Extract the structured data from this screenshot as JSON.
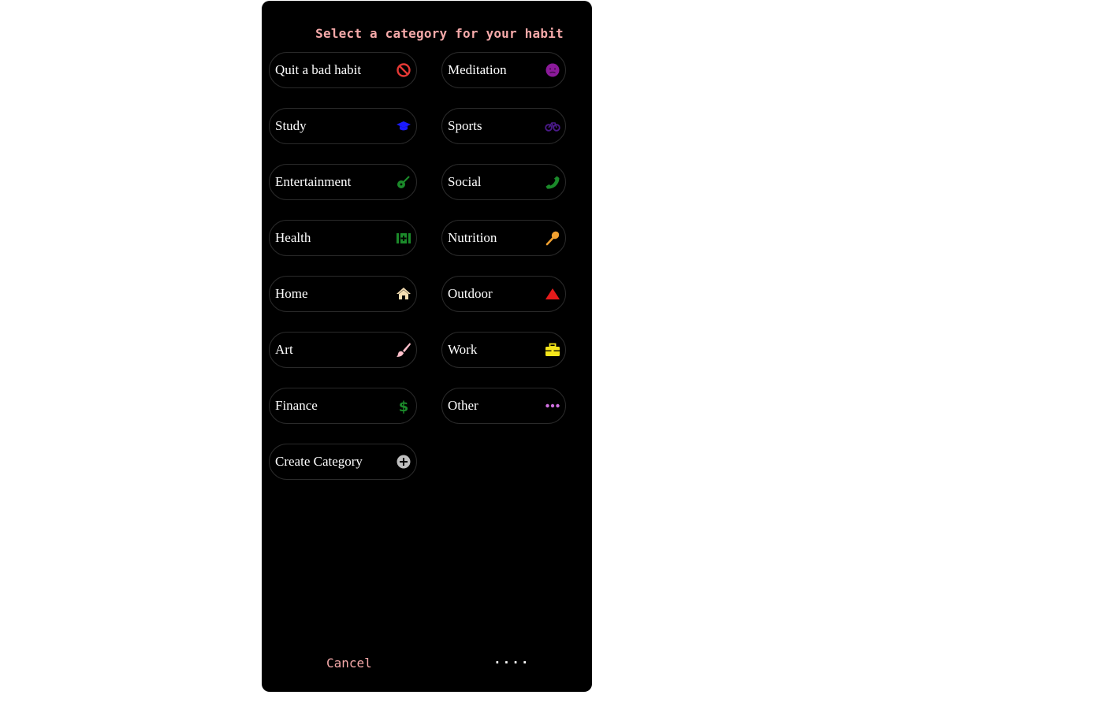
{
  "dialog": {
    "title": "Select a category for your habit",
    "categories_left": [
      {
        "label": "Quit a bad habit",
        "icon": "ban-icon",
        "color": "#e53935"
      },
      {
        "label": "Study",
        "icon": "graduation-cap-icon",
        "color": "#1a1aff"
      },
      {
        "label": "Entertainment",
        "icon": "guitar-icon",
        "color": "#1b8a2a"
      },
      {
        "label": "Health",
        "icon": "medkit-icon",
        "color": "#1b8a2a"
      },
      {
        "label": "Home",
        "icon": "house-icon",
        "color": "#f5deb3"
      },
      {
        "label": "Art",
        "icon": "paintbrush-icon",
        "color": "#ffc0cb"
      },
      {
        "label": "Finance",
        "icon": "dollar-icon",
        "color": "#1b8a2a"
      },
      {
        "label": "Create Category",
        "icon": "plus-circle-icon",
        "color": "#bfbfbf"
      }
    ],
    "categories_right": [
      {
        "label": "Meditation",
        "icon": "meditation-face-icon",
        "color": "#8b1a9a"
      },
      {
        "label": "Sports",
        "icon": "bicycle-icon",
        "color": "#4b1a8a"
      },
      {
        "label": "Social",
        "icon": "phone-icon",
        "color": "#1b8a2a"
      },
      {
        "label": "Nutrition",
        "icon": "spoon-icon",
        "color": "#f0a030"
      },
      {
        "label": "Outdoor",
        "icon": "mountain-icon",
        "color": "#e51b1b"
      },
      {
        "label": "Work",
        "icon": "briefcase-icon",
        "color": "#f5e61b"
      },
      {
        "label": "Other",
        "icon": "more-dots-icon",
        "color": "#d070e0"
      }
    ],
    "cancel_label": "Cancel",
    "dots_label": "...."
  }
}
